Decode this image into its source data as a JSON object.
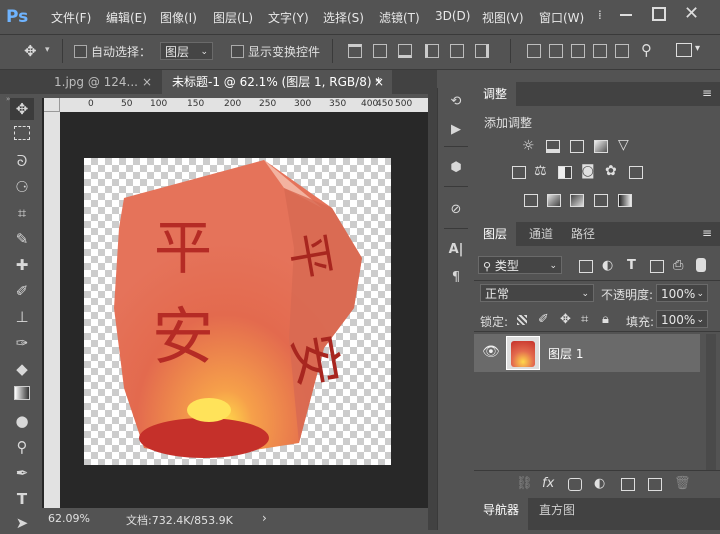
{
  "app": {
    "logo": "Ps"
  },
  "menu": [
    "文件(F)",
    "编辑(E)",
    "图像(I)",
    "图层(L)",
    "文字(Y)",
    "选择(S)",
    "滤镜(T)",
    "3D(D)",
    "视图(V)",
    "窗口(W)"
  ],
  "options": {
    "auto_select_label": "自动选择：",
    "layer_dropdown": "图层",
    "show_transform_label": "显示变换控件"
  },
  "tabs": [
    {
      "label": "1.jpg @ 124...",
      "close": "×"
    },
    {
      "label": "未标题-1 @ 62.1% (图层 1, RGB/8) *",
      "close": "×"
    }
  ],
  "ruler": {
    "top_ticks": [
      "0",
      "50",
      "100",
      "150",
      "200",
      "250",
      "300",
      "350",
      "400",
      "450",
      "500"
    ]
  },
  "status": {
    "zoom": "62.09%",
    "doc": "文档:732.4K/853.9K",
    "arrow": "›"
  },
  "adjust_panel": {
    "tab": "调整",
    "title": "添加调整"
  },
  "layers_panel": {
    "tabs": [
      "图层",
      "通道",
      "路径"
    ],
    "filter": "类型",
    "blend_mode": "正常",
    "opacity_label": "不透明度:",
    "opacity_value": "100%",
    "lock_label": "锁定:",
    "fill_label": "填充:",
    "fill_value": "100%",
    "layers": [
      {
        "name": "图层 1"
      }
    ]
  },
  "navigator": {
    "tabs": [
      "导航器",
      "直方图"
    ]
  },
  "colors": {
    "accent": "#6fb4ff",
    "selected_layer": "#6a6a6a"
  },
  "artwork": {
    "chars": [
      "平",
      "安",
      "平",
      "安"
    ]
  }
}
